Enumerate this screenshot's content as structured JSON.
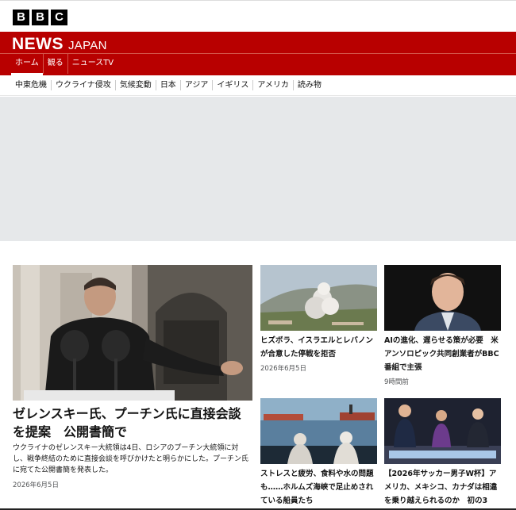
{
  "brand": {
    "bbc_letters": [
      "B",
      "B",
      "C"
    ],
    "news": "NEWS",
    "region": "JAPAN",
    "accent": "#b80000"
  },
  "primary_nav": [
    {
      "label": "ホーム",
      "active": true
    },
    {
      "label": "観る",
      "active": false
    },
    {
      "label": "ニュースTV",
      "active": false
    }
  ],
  "sub_nav": [
    "中東危機",
    "ウクライナ侵攻",
    "気候変動",
    "日本",
    "アジア",
    "イギリス",
    "アメリカ",
    "読み物"
  ],
  "lead_story": {
    "title": "ゼレンスキー氏、プーチン氏に直接会談を提案　公開書簡で",
    "summary": "ウクライナのゼレンスキー大統領は4日、ロシアのプーチン大統領に対し、戦争終結のために直接会談を呼びかけたと明らかにした。プーチン氏に宛てた公開書簡を発表した。",
    "date": "2026年6月5日"
  },
  "cards": [
    {
      "title": "ヒズボラ、イスラエルとレバノンが合意した停戦を拒否",
      "date": "2026年6月5日"
    },
    {
      "title": "AIの進化、遅らせる策が必要　米アンソロピック共同創業者がBBC番組で主張",
      "date": "9時間前"
    },
    {
      "title": "ストレスと疲労、食料や水の問題も……ホルムズ海峡で足止めされている船員たち",
      "date": ""
    },
    {
      "title": "【2026年サッカー男子W杯】アメリカ、メキシコ、カナダは相違を乗り越えられるのか　初の3",
      "date": ""
    }
  ]
}
